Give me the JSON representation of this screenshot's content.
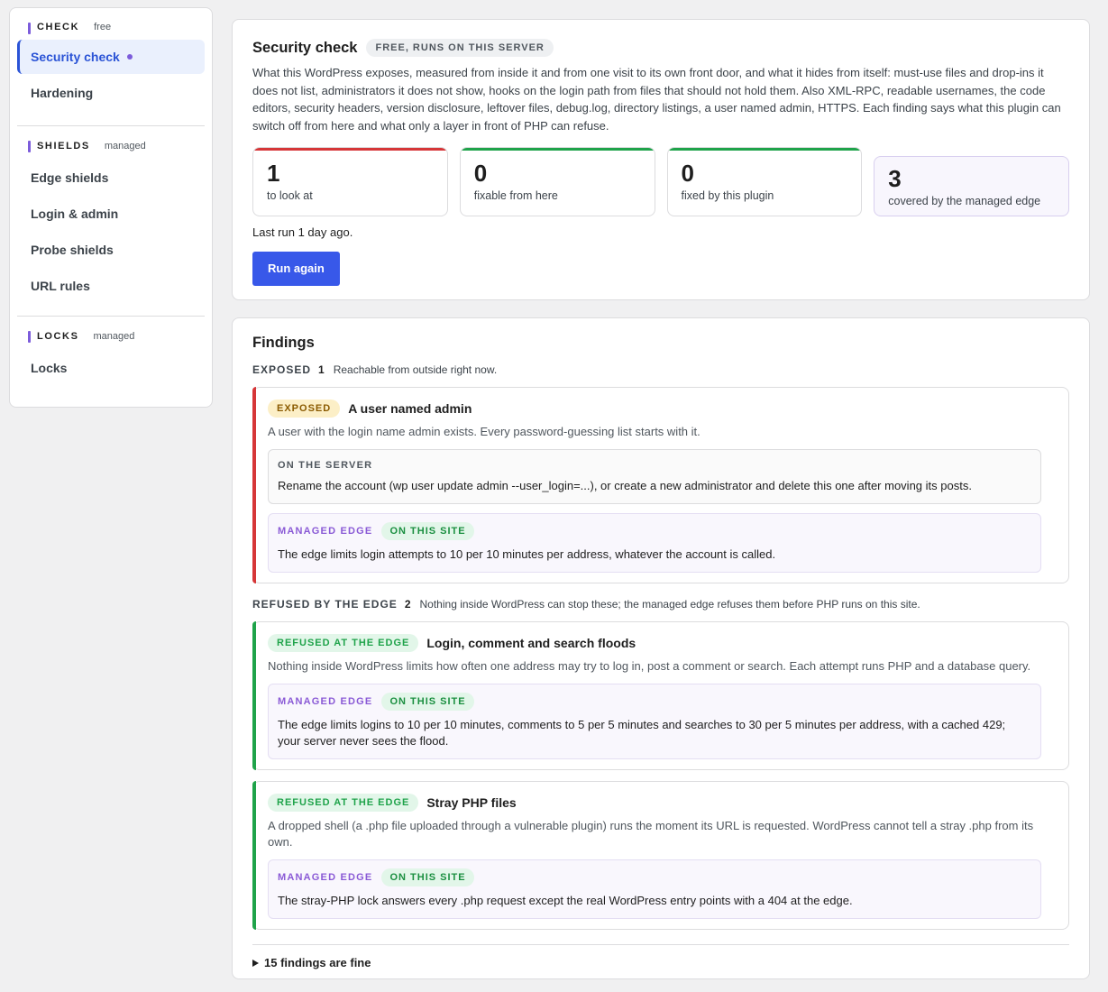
{
  "sidebar": {
    "check": {
      "title": "CHECK",
      "tag": "free",
      "items": [
        {
          "label": "Security check",
          "active": true
        },
        {
          "label": "Hardening"
        }
      ]
    },
    "shields": {
      "title": "SHIELDS",
      "tag": "managed",
      "items": [
        {
          "label": "Edge shields"
        },
        {
          "label": "Login & admin"
        },
        {
          "label": "Probe shields"
        },
        {
          "label": "URL rules"
        }
      ]
    },
    "locks": {
      "title": "LOCKS",
      "tag": "managed",
      "items": [
        {
          "label": "Locks"
        }
      ]
    }
  },
  "security_check": {
    "title": "Security check",
    "badge": "FREE, RUNS ON THIS SERVER",
    "intro": "What this WordPress exposes, measured from inside it and from one visit to its own front door, and what it hides from itself: must-use files and drop-ins it does not list, administrators it does not show, hooks on the login path from files that should not hold them. Also XML-RPC, readable usernames, the code editors, security headers, version disclosure, leftover files, debug.log, directory listings, a user named admin, HTTPS. Each finding says what this plugin can switch off from here and what only a layer in front of PHP can refuse.",
    "stats": [
      {
        "value": "1",
        "label": "to look at",
        "color": "#d63638"
      },
      {
        "value": "0",
        "label": "fixable from here",
        "color": "#1fa34a"
      },
      {
        "value": "0",
        "label": "fixed by this plugin",
        "color": "#1fa34a"
      },
      {
        "value": "3",
        "label": "covered by the managed edge",
        "color": "#7c5cdb"
      }
    ],
    "last_run": "Last run 1 day ago.",
    "run_button": "Run again"
  },
  "findings": {
    "title": "Findings",
    "groups": [
      {
        "name": "EXPOSED",
        "count": "1",
        "desc": "Reachable from outside right now.",
        "items": [
          {
            "tag": "EXPOSED",
            "name": "A user named admin",
            "desc": "A user with the login name admin exists. Every password-guessing list starts with it.",
            "server": {
              "label": "ON THE SERVER",
              "text": "Rename the account (wp user update admin --user_login=...), or create a new administrator and delete this one after moving its posts."
            },
            "edge": {
              "label": "MANAGED EDGE",
              "site_tag": "ON THIS SITE",
              "text": "The edge limits login attempts to 10 per 10 minutes per address, whatever the account is called."
            }
          }
        ]
      },
      {
        "name": "REFUSED BY THE EDGE",
        "count": "2",
        "desc": "Nothing inside WordPress can stop these; the managed edge refuses them before PHP runs on this site.",
        "items": [
          {
            "tag": "REFUSED AT THE EDGE",
            "name": "Login, comment and search floods",
            "desc": "Nothing inside WordPress limits how often one address may try to log in, post a comment or search. Each attempt runs PHP and a database query.",
            "edge": {
              "label": "MANAGED EDGE",
              "site_tag": "ON THIS SITE",
              "text": "The edge limits logins to 10 per 10 minutes, comments to 5 per 5 minutes and searches to 30 per 5 minutes per address, with a cached 429; your server never sees the flood."
            }
          },
          {
            "tag": "REFUSED AT THE EDGE",
            "name": "Stray PHP files",
            "desc": "A dropped shell (a .php file uploaded through a vulnerable plugin) runs the moment its URL is requested. WordPress cannot tell a stray .php from its own.",
            "edge": {
              "label": "MANAGED EDGE",
              "site_tag": "ON THIS SITE",
              "text": "The stray-PHP lock answers every .php request except the real WordPress entry points with a 404 at the edge."
            }
          }
        ]
      }
    ],
    "fine_toggle": "15 findings are fine"
  }
}
